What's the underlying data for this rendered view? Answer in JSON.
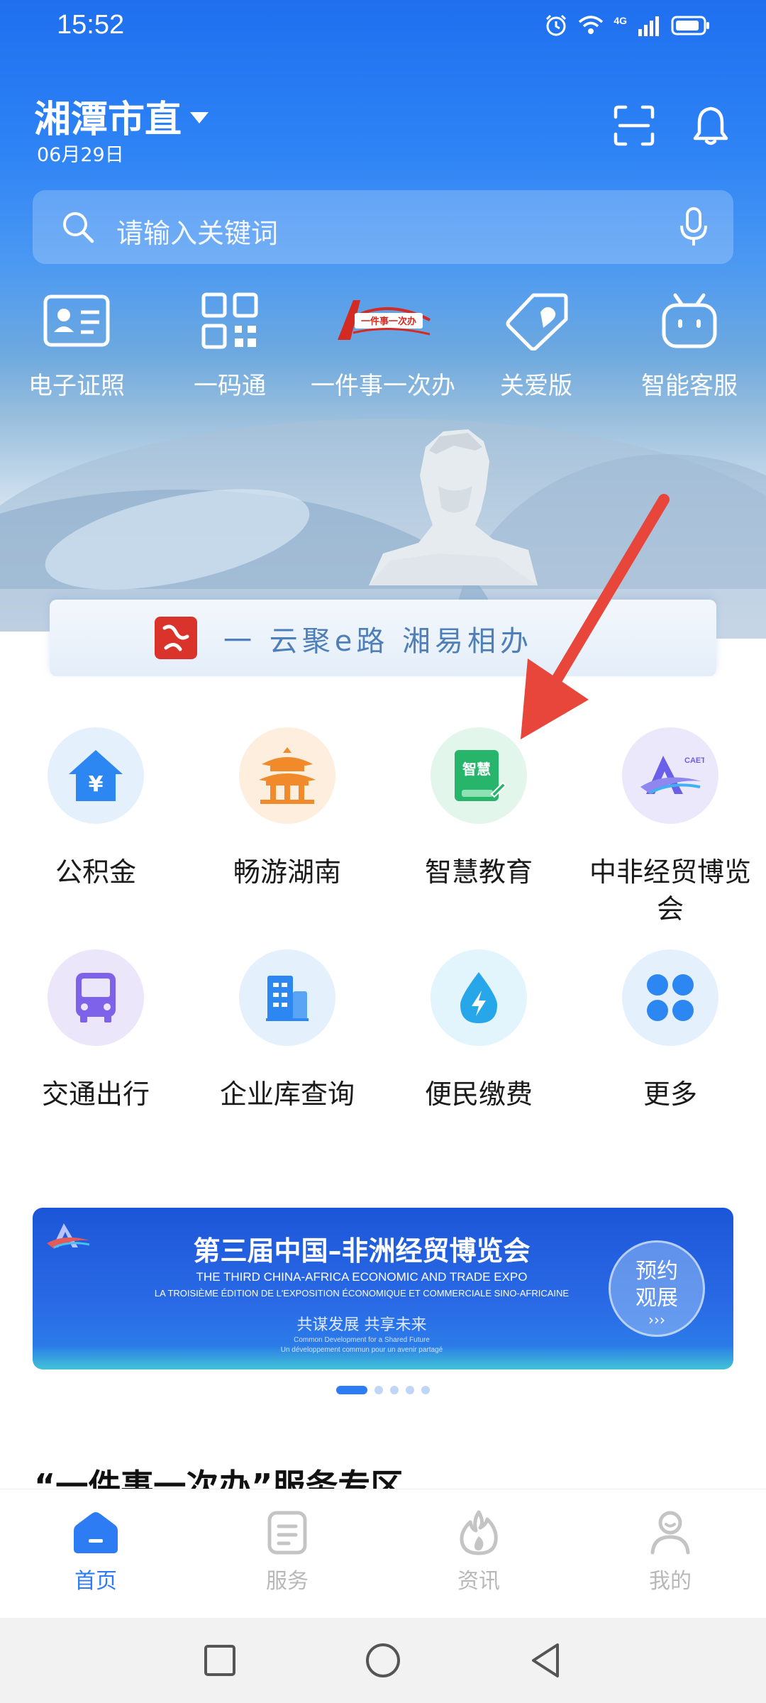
{
  "status_bar": {
    "time": "15:52",
    "network": "4G"
  },
  "header": {
    "city": "湘潭市直",
    "date": "06月29日"
  },
  "search": {
    "placeholder": "请输入关键词"
  },
  "quick_actions": [
    {
      "label": "电子证照",
      "icon": "id-card-icon"
    },
    {
      "label": "一码通",
      "icon": "qr-code-icon"
    },
    {
      "label": "一件事一次办",
      "icon": "one-thing-logo-icon",
      "logo_text": "一件事一次办"
    },
    {
      "label": "关爱版",
      "icon": "care-tag-icon"
    },
    {
      "label": "智能客服",
      "icon": "robot-icon"
    }
  ],
  "slogan": {
    "text": "一 云聚e路 湘易相办"
  },
  "services": [
    {
      "label": "公积金",
      "icon": "housing-fund-icon",
      "badge": "¥"
    },
    {
      "label": "畅游湖南",
      "icon": "pavilion-icon"
    },
    {
      "label": "智慧教育",
      "icon": "smart-education-icon",
      "badge": "智慧"
    },
    {
      "label": "中非经贸博览会",
      "icon": "caete-logo-icon",
      "badge": "CAETE"
    },
    {
      "label": "交通出行",
      "icon": "bus-icon"
    },
    {
      "label": "企业库查询",
      "icon": "building-icon"
    },
    {
      "label": "便民缴费",
      "icon": "water-drop-icon"
    },
    {
      "label": "更多",
      "icon": "more-grid-icon"
    }
  ],
  "promo": {
    "title": "第三届中国–非洲经贸博览会",
    "subtitle_en": "THE THIRD CHINA-AFRICA ECONOMIC AND TRADE EXPO",
    "subtitle_fr": "LA TROISIÈME ÉDITION DE L'EXPOSITION ÉCONOMIQUE ET COMMERCIALE SINO-AFRICAINE",
    "slogan_cn": "共谋发展  共享未来",
    "slogan_en": "Common Development for a Shared Future",
    "slogan_fr": "Un développement commun pour un avenir partagé",
    "button": "预约\n观展",
    "button_line1": "预约",
    "button_line2": "观展",
    "button_chevron": "›››",
    "slide_count": 5,
    "active_slide": 1
  },
  "section": {
    "title": "“一件事一次办”服务专区"
  },
  "tabs": [
    {
      "label": "首页",
      "icon": "home-icon",
      "active": true
    },
    {
      "label": "服务",
      "icon": "service-doc-icon",
      "active": false
    },
    {
      "label": "资讯",
      "icon": "flame-icon",
      "active": false
    },
    {
      "label": "我的",
      "icon": "user-icon",
      "active": false
    }
  ],
  "colors": {
    "primary": "#2d7cf3",
    "arrow": "#e8463b",
    "tab_inactive": "#b8b8b8"
  }
}
